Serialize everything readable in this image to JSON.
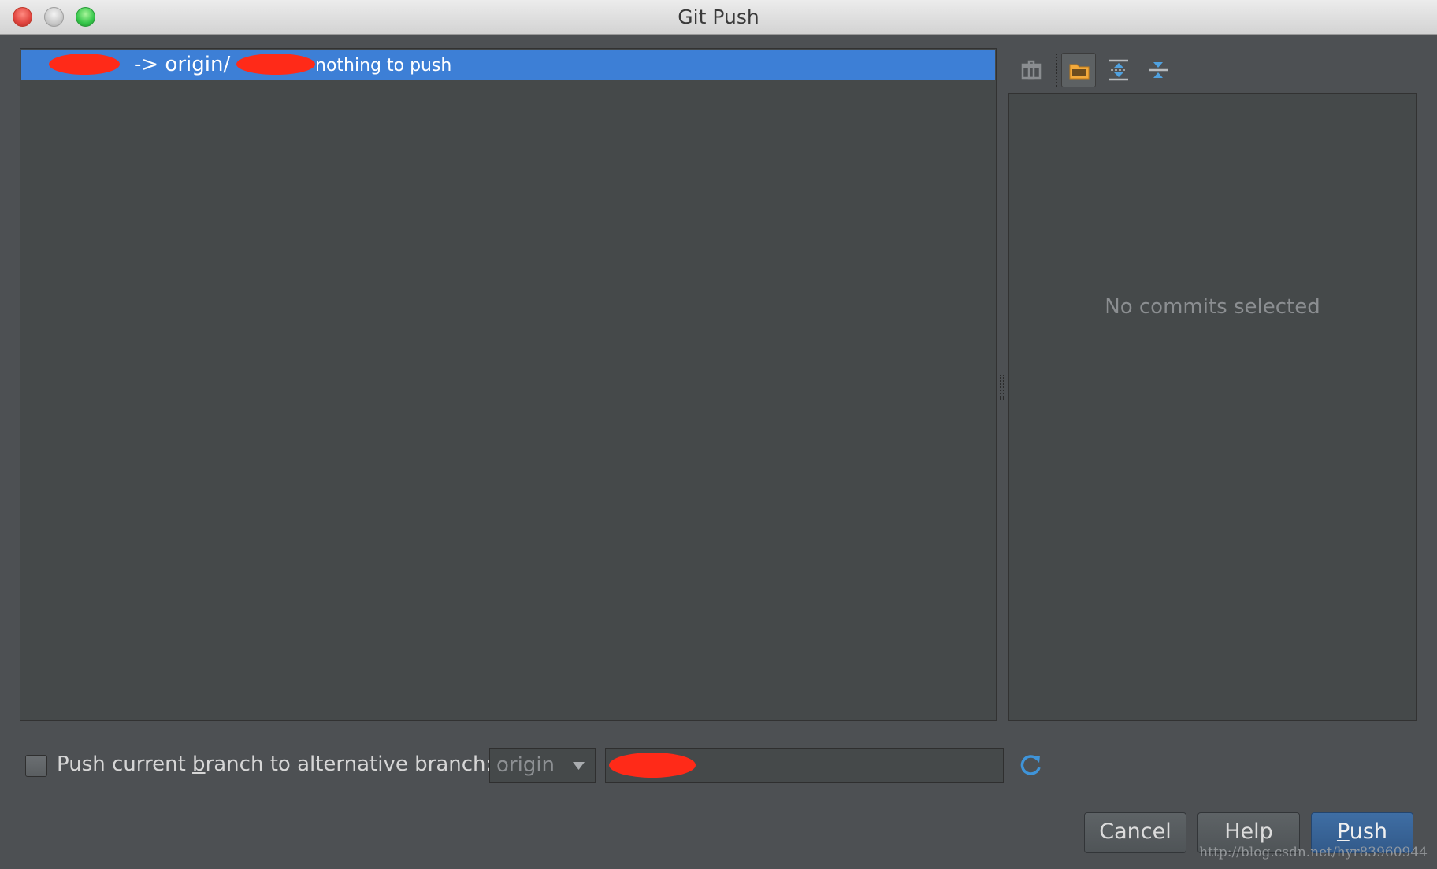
{
  "window": {
    "title": "Git Push"
  },
  "repo_row": {
    "arrow": "-> origin/",
    "status": "nothing to push"
  },
  "details": {
    "empty_text": "No commits selected"
  },
  "alt_branch": {
    "label_prefix": "Push current ",
    "label_mnemonic": "b",
    "label_suffix": "ranch to alternative branch:",
    "remote_value": "origin"
  },
  "buttons": {
    "cancel": "Cancel",
    "help": "Help",
    "push_mnemonic": "P",
    "push_rest": "ush"
  },
  "watermark": "http://blog.csdn.net/hyr83960944",
  "colors": {
    "selection": "#3d7fd6",
    "redaction": "#ff2a18",
    "background": "#4d5053"
  },
  "icons": [
    "close-button",
    "minimize-button",
    "zoom-button",
    "package-icon",
    "folder-group-icon",
    "expand-all-icon",
    "collapse-all-icon",
    "dropdown-arrow-icon",
    "refresh-icon"
  ]
}
